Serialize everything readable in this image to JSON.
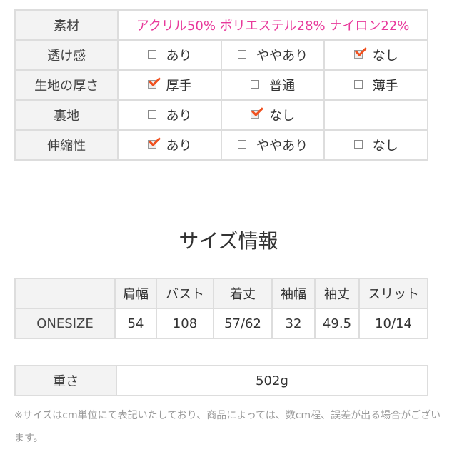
{
  "material": {
    "label": "素材",
    "value": "アクリル50% ポリエステル28% ナイロン22%",
    "value_color": "#e8399b"
  },
  "attributes": [
    {
      "label": "透け感",
      "options": [
        {
          "text": "あり",
          "checked": false
        },
        {
          "text": "ややあり",
          "checked": false
        },
        {
          "text": "なし",
          "checked": true
        }
      ]
    },
    {
      "label": "生地の厚さ",
      "options": [
        {
          "text": "厚手",
          "checked": true
        },
        {
          "text": "普通",
          "checked": false
        },
        {
          "text": "薄手",
          "checked": false
        }
      ]
    },
    {
      "label": "裏地",
      "options": [
        {
          "text": "あり",
          "checked": false
        },
        {
          "text": "なし",
          "checked": true
        },
        {
          "text": "",
          "checked": null
        }
      ]
    },
    {
      "label": "伸縮性",
      "options": [
        {
          "text": "あり",
          "checked": true
        },
        {
          "text": "ややあり",
          "checked": false
        },
        {
          "text": "なし",
          "checked": false
        }
      ]
    }
  ],
  "check_color": "#f0501e",
  "size_info": {
    "title": "サイズ情報",
    "headers": [
      "",
      "肩幅",
      "バスト",
      "着丈",
      "袖幅",
      "袖丈",
      "スリット"
    ],
    "rows": [
      [
        "ONESIZE",
        "54",
        "108",
        "57/62",
        "32",
        "49.5",
        "10/14"
      ]
    ]
  },
  "weight": {
    "label": "重さ",
    "value": "502g"
  },
  "note": "※サイズはcm単位にて表記いたしており、商品によっては、数cm程、誤差が出る場合がございます。"
}
